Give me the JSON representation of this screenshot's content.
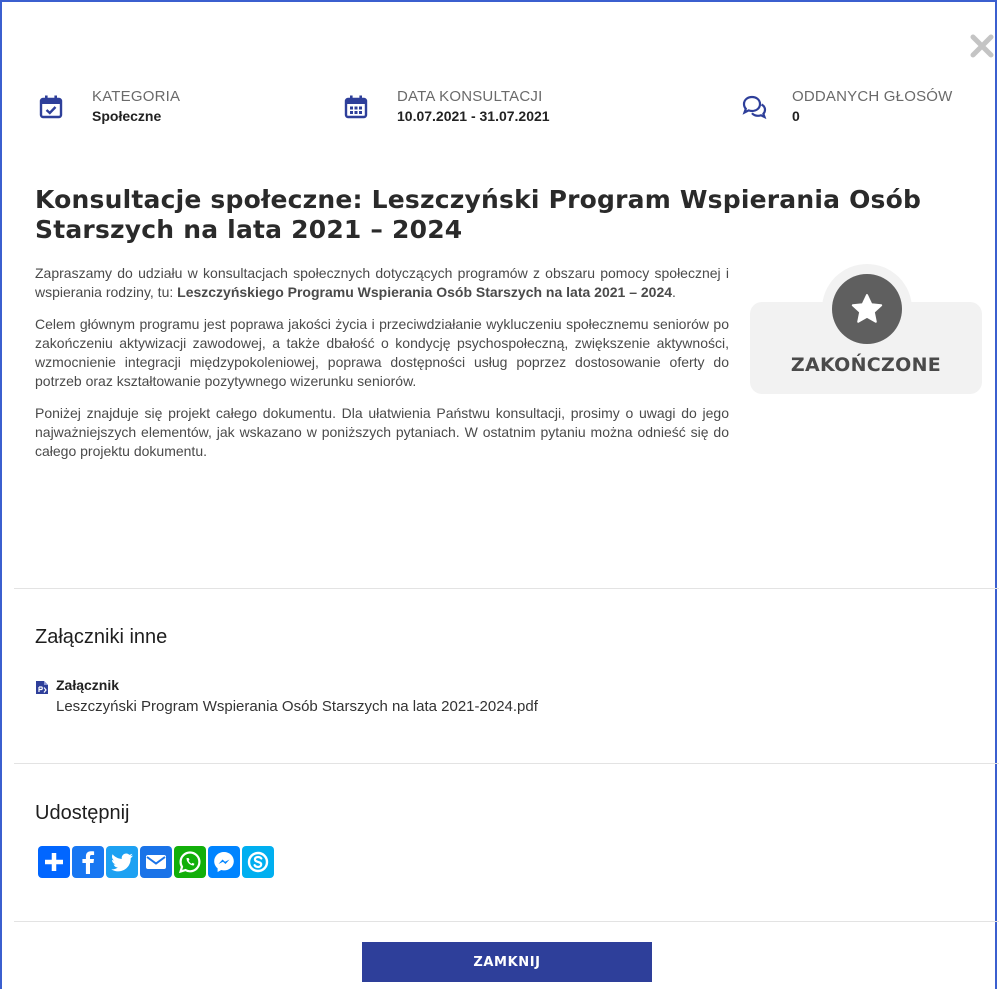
{
  "meta": [
    {
      "label": "KATEGORIA",
      "value": "Społeczne",
      "icon": "calendar-check-icon"
    },
    {
      "label": "DATA KONSULTACJI",
      "value": "10.07.2021 - 31.07.2021",
      "icon": "calendar-icon"
    },
    {
      "label": "ODDANYCH GŁOSÓW",
      "value": "0",
      "icon": "comments-icon"
    }
  ],
  "title": "Konsultacje społeczne: Leszczyński Program Wspierania Osób Starszych na lata 2021 – 2024",
  "description": {
    "p1_start": "Zapraszamy do udziału w konsultacjach społecznych dotyczących programów z obszaru pomocy społecznej i wspierania rodziny, tu: ",
    "p1_bold": "Leszczyńskiego Programu Wspierania Osób Starszych na lata 2021 – 2024",
    "p1_end": ".",
    "p2": "Celem głównym programu jest poprawa jakości życia i przeciwdziałanie wykluczeniu społecznemu seniorów po zakończeniu aktywizacji zawodowej, a także dbałość o kondycję psychospołeczną, zwiększenie aktywności, wzmocnienie integracji międzypokoleniowej, poprawa dostępności usług poprzez dostosowanie oferty do potrzeb oraz kształtowanie pozytywnego wizerunku seniorów.",
    "p3": "Poniżej znajduje się projekt całego dokumentu. Dla ułatwienia Państwu konsultacji, prosimy o uwagi do jego najważniejszych elementów, jak wskazano w poniższych pytaniach. W ostatnim pytaniu można odnieść się do całego projektu dokumentu."
  },
  "status": {
    "label": "ZAKOŃCZONE",
    "icon": "star-icon"
  },
  "attachments": {
    "heading": "Załączniki inne",
    "items": [
      {
        "title": "Załącznik",
        "file": "Leszczyński Program Wspierania Osób Starszych na lata 2021-2024.pdf",
        "icon": "file-pdf-icon"
      }
    ]
  },
  "share": {
    "heading": "Udostępnij",
    "buttons": [
      {
        "name": "share-more",
        "icon": "plus-icon",
        "color": "#0166ff"
      },
      {
        "name": "facebook",
        "icon": "facebook-icon",
        "color": "#1877f2"
      },
      {
        "name": "twitter",
        "icon": "twitter-icon",
        "color": "#1da1f2"
      },
      {
        "name": "email",
        "icon": "envelope-icon",
        "color": "#1a73e8"
      },
      {
        "name": "whatsapp",
        "icon": "whatsapp-icon",
        "color": "#12af0a"
      },
      {
        "name": "messenger",
        "icon": "messenger-icon",
        "color": "#0084ff"
      },
      {
        "name": "skype",
        "icon": "skype-icon",
        "color": "#00aff0"
      }
    ]
  },
  "close_button": "ZAMKNIJ",
  "colors": {
    "accent": "#2e3f9a",
    "icon": "#2e3f9a",
    "status_bg": "#f2f2f2",
    "status_icon": "#5f5f5f"
  }
}
